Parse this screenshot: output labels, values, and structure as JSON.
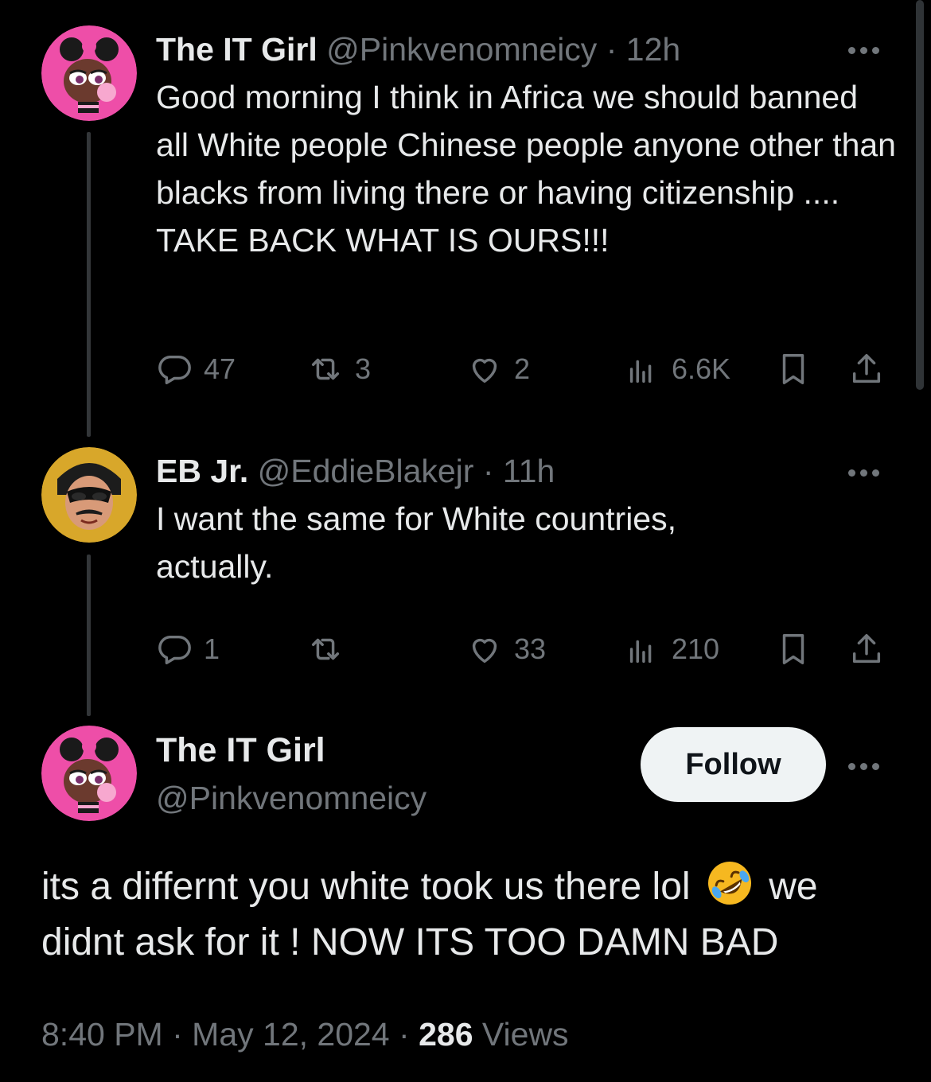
{
  "colors": {
    "background": "#000000",
    "text_primary": "#e7e9ea",
    "text_secondary": "#71767b",
    "thread_line": "#333639",
    "follow_button_bg": "#eff3f4"
  },
  "thread": [
    {
      "avatar_icon": "cartoon-girl-avatar",
      "name": "The IT Girl",
      "handle": "@Pinkvenomneicy",
      "separator": "·",
      "time": "12h",
      "text": "Good morning I think in Africa we should banned all White people Chinese people anyone other than blacks from living there or having citizenship .... TAKE BACK WHAT IS OURS!!!",
      "replies": "47",
      "reposts": "3",
      "likes": "2",
      "views": "6.6K"
    },
    {
      "avatar_icon": "masked-man-avatar",
      "name": "EB Jr.",
      "handle": "@EddieBlakejr",
      "separator": "·",
      "time": "11h",
      "text": "I want the same for White countries, actually.",
      "replies": "1",
      "reposts": "",
      "likes": "33",
      "views": "210"
    }
  ],
  "main_tweet": {
    "avatar_icon": "cartoon-girl-avatar",
    "name": "The IT Girl",
    "handle": "@Pinkvenomneicy",
    "follow_label": "Follow",
    "text_part1": "its a differnt you white took us there lol",
    "emoji": "rolling-on-floor-laughing-emoji",
    "text_part2": "we didnt ask for it ! NOW ITS TOO DAMN BAD",
    "time": "8:40 PM",
    "date": "May 12, 2024",
    "separator": "·",
    "views_count": "286",
    "views_label": "Views"
  }
}
